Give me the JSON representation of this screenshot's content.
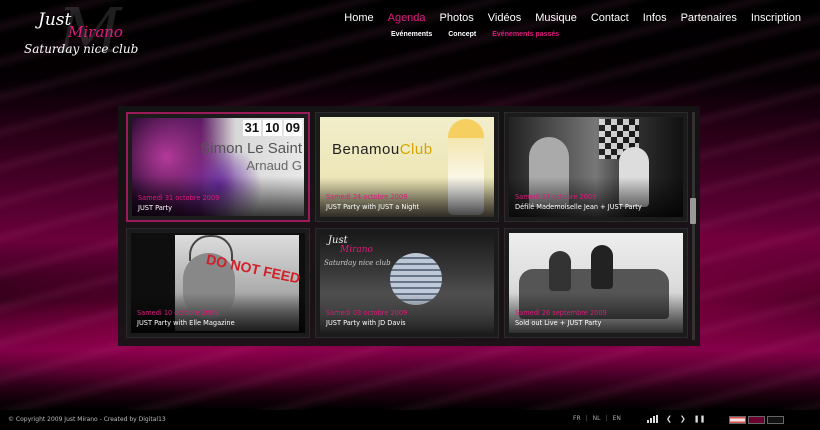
{
  "logo": {
    "line1": "Just",
    "line2": "Mirano",
    "line3": "Saturday nice club",
    "mark": "M"
  },
  "nav": [
    {
      "label": "Home",
      "active": false
    },
    {
      "label": "Agenda",
      "active": true
    },
    {
      "label": "Photos",
      "active": false
    },
    {
      "label": "Vidéos",
      "active": false
    },
    {
      "label": "Musique",
      "active": false
    },
    {
      "label": "Contact",
      "active": false
    },
    {
      "label": "Infos",
      "active": false
    },
    {
      "label": "Partenaires",
      "active": false
    },
    {
      "label": "Inscription",
      "active": false
    }
  ],
  "subnav": [
    {
      "label": "Evénements",
      "active": false
    },
    {
      "label": "Concept",
      "active": false
    },
    {
      "label": "Evénements passés",
      "active": true
    }
  ],
  "events": [
    {
      "date": "Samedi 31 octobre 2009",
      "title": "JUST Party",
      "selected": true,
      "poster": {
        "day": "31",
        "month": "10",
        "year": "09",
        "name1": "Simon Le Saint",
        "name2": "Arnaud G"
      }
    },
    {
      "date": "Samedi 24 octobre 2009",
      "title": "JUST Party with JUST a Night",
      "selected": false,
      "poster": {
        "brand_a": "Benamou",
        "brand_b": "Club"
      }
    },
    {
      "date": "Samedi 17 octobre 2009",
      "title": "Défilé Mademoiselle Jean + JUST Party",
      "selected": false
    },
    {
      "date": "Samedi 10 octobre 2009",
      "title": "JUST Party with Elle Magazine",
      "selected": false,
      "poster": {
        "text": "DO NOT FEED THE"
      }
    },
    {
      "date": "Samedi 03 octobre 2009",
      "title": "JUST Party with JD Davis",
      "selected": false,
      "poster": {
        "line1": "Just",
        "line2": "Mirano",
        "line3": "Saturday nice club"
      }
    },
    {
      "date": "Samedi 26 septembre 2009",
      "title": "Sold out Live + JUST Party",
      "selected": false
    }
  ],
  "footer": {
    "copyright": "© Copyright 2009 Just Mirano - Created by Digital13",
    "languages": [
      "FR",
      "NL",
      "EN"
    ],
    "controls": [
      "volume-bars-icon",
      "prev-icon",
      "next-icon",
      "pause-icon"
    ]
  },
  "colors": {
    "accent": "#e0197d",
    "background": "#000000"
  }
}
